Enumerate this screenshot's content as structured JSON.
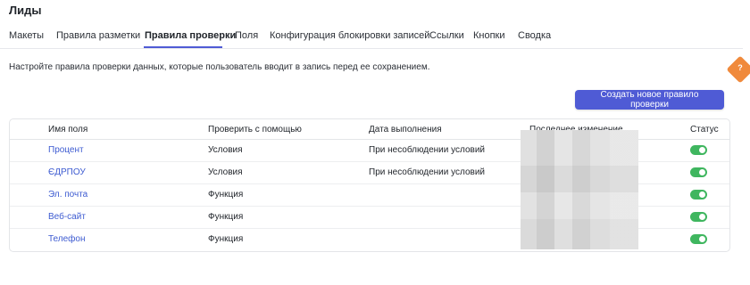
{
  "page": {
    "title": "Лиды"
  },
  "tabs": [
    {
      "label": "Макеты"
    },
    {
      "label": "Правила разметки"
    },
    {
      "label": "Правила проверки"
    },
    {
      "label": "Поля"
    },
    {
      "label": "Конфигурация блокировки записей"
    },
    {
      "label": "Ссылки"
    },
    {
      "label": "Кнопки"
    },
    {
      "label": "Сводка"
    }
  ],
  "active_tab": "Правила проверки",
  "description": "Настройте правила проверки данных, которые пользователь вводит в запись перед ее сохранением.",
  "create_button": {
    "label": "Создать новое правило проверки"
  },
  "table": {
    "headers": {
      "field_name": "Имя поля",
      "validate_with": "Проверить с помощью",
      "execution": "Дата выполнения",
      "last_modified": "Последнее изменение",
      "status": "Статус"
    },
    "rows": [
      {
        "field_name": "Процент",
        "validate_with": "Условия",
        "execution": "При несоблюдении условий",
        "status": "on"
      },
      {
        "field_name": "ЄДРПОУ",
        "validate_with": "Условия",
        "execution": "При несоблюдении условий",
        "status": "on"
      },
      {
        "field_name": "Эл. почта",
        "validate_with": "Функция",
        "execution": "",
        "status": "on"
      },
      {
        "field_name": "Веб-сайт",
        "validate_with": "Функция",
        "execution": "",
        "status": "on"
      },
      {
        "field_name": "Телефон",
        "validate_with": "Функция",
        "execution": "",
        "status": "on"
      }
    ]
  },
  "help_badge": {
    "label": "?"
  },
  "colors": {
    "accent": "#4f5bd5",
    "link": "#3d5bd1",
    "toggle_on": "#3fb65f",
    "help": "#f08a3c"
  }
}
